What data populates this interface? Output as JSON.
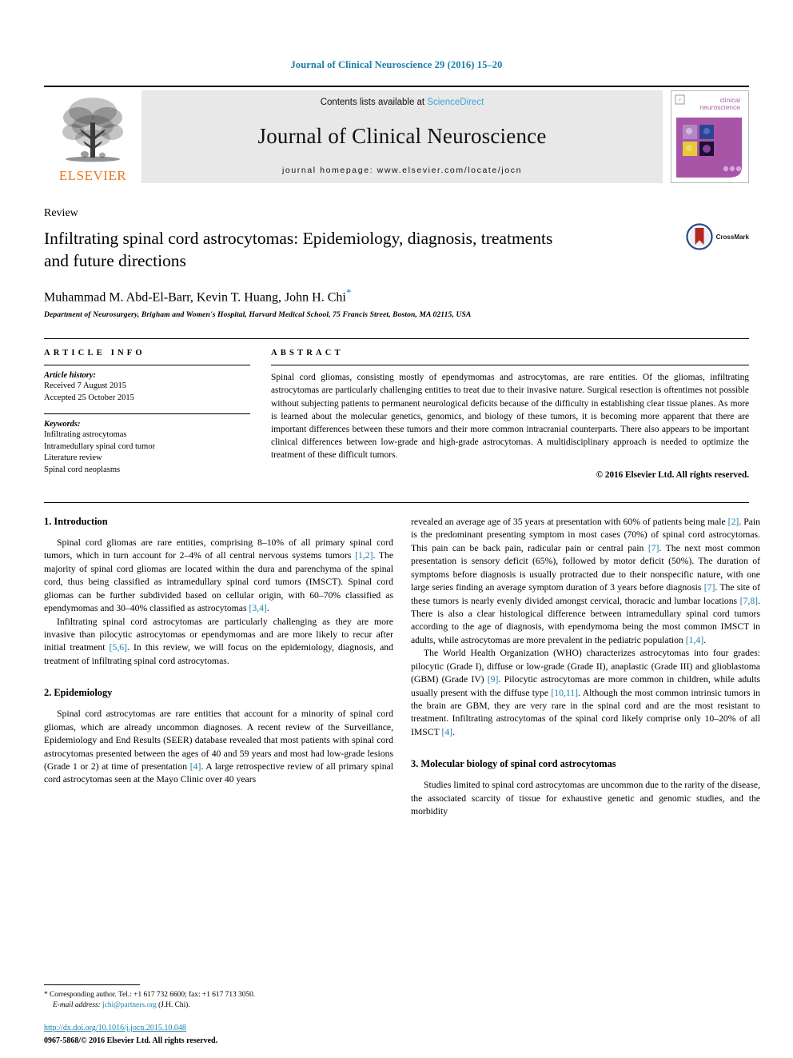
{
  "running_head": "Journal of Clinical Neuroscience 29 (2016) 15–20",
  "masthead": {
    "publisher_name": "ELSEVIER",
    "contents_prefix": "Contents lists available at",
    "contents_brand": "ScienceDirect",
    "journal_title": "Journal of Clinical Neuroscience",
    "homepage": "journal homepage: www.elsevier.com/locate/jocn",
    "cover_title_line1": "clinical",
    "cover_title_line2": "neuroscience"
  },
  "article": {
    "category": "Review",
    "title": "Infiltrating spinal cord astrocytomas: Epidemiology, diagnosis, treatments and future directions",
    "authors": "Muhammad M. Abd-El-Barr, Kevin T. Huang, John H. Chi",
    "corresponding_marker": "*",
    "affiliation": "Department of Neurosurgery, Brigham and Women's Hospital, Harvard Medical School, 75 Francis Street, Boston, MA 02115, USA",
    "crossmark_label": "CrossMark"
  },
  "article_info": {
    "heading": "ARTICLE INFO",
    "history_label": "Article history:",
    "received": "Received 7 August 2015",
    "accepted": "Accepted 25 October 2015",
    "keywords_label": "Keywords:",
    "keywords": [
      "Infiltrating astrocytomas",
      "Intramedullary spinal cord tumor",
      "Literature review",
      "Spinal cord neoplasms"
    ]
  },
  "abstract": {
    "heading": "ABSTRACT",
    "text": "Spinal cord gliomas, consisting mostly of ependymomas and astrocytomas, are rare entities. Of the gliomas, infiltrating astrocytomas are particularly challenging entities to treat due to their invasive nature. Surgical resection is oftentimes not possible without subjecting patients to permanent neurological deficits because of the difficulty in establishing clear tissue planes. As more is learned about the molecular genetics, genomics, and biology of these tumors, it is becoming more apparent that there are important differences between these tumors and their more common intracranial counterparts. There also appears to be important clinical differences between low-grade and high-grade astrocytomas. A multidisciplinary approach is needed to optimize the treatment of these difficult tumors.",
    "copyright": "© 2016 Elsevier Ltd. All rights reserved."
  },
  "body": {
    "left": {
      "intro_heading": "1. Introduction",
      "intro_p1_a": "Spinal cord gliomas are rare entities, comprising 8–10% of all primary spinal cord tumors, which in turn account for 2–4% of all central nervous systems tumors ",
      "intro_p1_cite1": "[1,2]",
      "intro_p1_b": ". The majority of spinal cord gliomas are located within the dura and parenchyma of the spinal cord, thus being classified as intramedullary spinal cord tumors (IMSCT). Spinal cord gliomas can be further subdivided based on cellular origin, with 60–70% classified as ependymomas and 30–40% classified as astrocytomas ",
      "intro_p1_cite2": "[3,4]",
      "intro_p1_c": ".",
      "intro_p2_a": "Infiltrating spinal cord astrocytomas are particularly challenging as they are more invasive than pilocytic astrocytomas or ependymomas and are more likely to recur after initial treatment ",
      "intro_p2_cite1": "[5,6]",
      "intro_p2_b": ". In this review, we will focus on the epidemiology, diagnosis, and treatment of infiltrating spinal cord astrocytomas.",
      "epi_heading": "2. Epidemiology",
      "epi_p1_a": "Spinal cord astrocytomas are rare entities that account for a minority of spinal cord gliomas, which are already uncommon diagnoses. A recent review of the Surveillance, Epidemiology and End Results (SEER) database revealed that most patients with spinal cord astrocytomas presented between the ages of 40 and 59 years and most had low-grade lesions (Grade 1 or 2) at time of presentation ",
      "epi_p1_cite1": "[4]",
      "epi_p1_b": ". A large retrospective review of all primary spinal cord astrocytomas seen at the Mayo Clinic over 40 years"
    },
    "right": {
      "p1_a": "revealed an average age of 35 years at presentation with 60% of patients being male ",
      "p1_cite1": "[2]",
      "p1_b": ". Pain is the predominant presenting symptom in most cases (70%) of spinal cord astrocytomas. This pain can be back pain, radicular pain or central pain ",
      "p1_cite2": "[7]",
      "p1_c": ". The next most common presentation is sensory deficit (65%), followed by motor deficit (50%). The duration of symptoms before diagnosis is usually protracted due to their nonspecific nature, with one large series finding an average symptom duration of 3 years before diagnosis ",
      "p1_cite3": "[7]",
      "p1_d": ". The site of these tumors is nearly evenly divided amongst cervical, thoracic and lumbar locations ",
      "p1_cite4": "[7,8]",
      "p1_e": ". There is also a clear histological difference between intramedullary spinal cord tumors according to the age of diagnosis, with ependymoma being the most common IMSCT in adults, while astrocytomas are more prevalent in the pediatric population ",
      "p1_cite5": "[1,4]",
      "p1_f": ".",
      "p2_a": "The World Health Organization (WHO) characterizes astrocytomas into four grades: pilocytic (Grade I), diffuse or low-grade (Grade II), anaplastic (Grade III) and glioblastoma (GBM) (Grade IV) ",
      "p2_cite1": "[9]",
      "p2_b": ". Pilocytic astrocytomas are more common in children, while adults usually present with the diffuse type ",
      "p2_cite2": "[10,11]",
      "p2_c": ". Although the most common intrinsic tumors in the brain are GBM, they are very rare in the spinal cord and are the most resistant to treatment. Infiltrating astrocytomas of the spinal cord likely comprise only 10–20% of all IMSCT ",
      "p2_cite3": "[4]",
      "p2_d": ".",
      "mol_heading": "3. Molecular biology of spinal cord astrocytomas",
      "mol_p1": "Studies limited to spinal cord astrocytomas are uncommon due to the rarity of the disease, the associated scarcity of tissue for exhaustive genetic and genomic studies, and the morbidity"
    }
  },
  "footnotes": {
    "corresponding_marker": "*",
    "corresponding": "Corresponding author. Tel.: +1 617 732 6600; fax: +1 617 713 3050.",
    "email_label": "E-mail address:",
    "email": "jchi@partners.org",
    "email_suffix": "(J.H. Chi).",
    "doi": "http://dx.doi.org/10.1016/j.jocn.2015.10.048",
    "issn": "0967-5868/© 2016 Elsevier Ltd. All rights reserved."
  },
  "colors": {
    "link": "#1a7fa8",
    "elsevier_orange": "#E87722",
    "sciencedirect": "#3aa6d8",
    "cover_purple": "#a855a8"
  }
}
